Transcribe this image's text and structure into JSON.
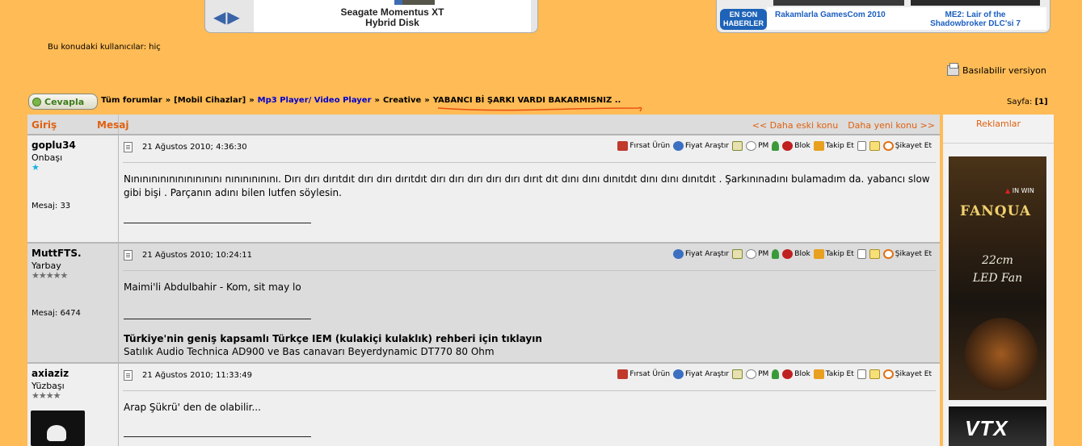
{
  "banners": {
    "left": {
      "title_line1": "Seagate Momentus XT",
      "title_line2": "Hybrid Disk",
      "prev_arrow": "◀",
      "next_arrow": "▶"
    },
    "right": {
      "badge_line1": "EN SON",
      "badge_line2": "HABERLER",
      "news1": "Rakamlarla GamesCom 2010",
      "news2_line1": "ME2: Lair of the",
      "news2_line2": "Shadowbroker DLC'si 7"
    }
  },
  "viewers_text": "Bu konudaki kullanıcılar: hiç",
  "printable_label": "Basılabilir versiyon",
  "reply_button": "Cevapla",
  "breadcrumb": {
    "items": [
      "Tüm forumlar",
      "[Mobil Cihazlar]",
      "Mp3 Player/ Video Player",
      "Creative",
      "YABANCI Bİ ŞARKI VARDI BAKARMISNIZ .."
    ],
    "separator": "»"
  },
  "page_info": {
    "label": "Sayfa:",
    "value": "[1]"
  },
  "thread_header": {
    "login": "Giriş",
    "message": "Mesaj",
    "prev": "<< Daha eski konu",
    "next": "Daha yeni konu >>"
  },
  "action_labels": {
    "deal": "Fırsat Ürün",
    "price": "Fiyat Araştır",
    "pm": "PM",
    "block": "Blok",
    "follow": "Takip Et",
    "report": "Şikayet Et"
  },
  "posts": [
    {
      "username": "goplu34",
      "rank": "Onbaşı",
      "stars": "★",
      "message_count": "Mesaj: 33",
      "timestamp": "21 Ağustos 2010; 4:36:30",
      "text": "Nınınınınınınınınınını nınınınınını. Dırı dırı dırıtdıt dırı dırı dırıtdıt dırı dırı dırı dırı dırı dırıt dıt dını dını dınıtdıt dını dını dınıtdıt . Şarkınınadını bulamadım da. yabancı slow gibi bişi . Parçanın adını bilen lutfen söylesin."
    },
    {
      "username": "MuttFTS.",
      "rank": "Yarbay",
      "stars": "★★★★★",
      "message_count": "Mesaj: 6474",
      "timestamp": "21 Ağustos 2010; 10:24:11",
      "text": "Maimi'li Abdulbahir - Kom, sit may lo",
      "signature_bold": "Türkiye'nin geniş kapsamlı Türkçe IEM (kulakiçi kulaklık) rehberi için tıklayın",
      "signature_sub": "Satılık Audio Technica AD900 ve Bas canavarı Beyerdynamic DT770 80 Ohm"
    },
    {
      "username": "axiaziz",
      "rank": "Yüzbaşı",
      "stars": "★★★★",
      "timestamp": "21 Ağustos 2010; 11:33:49",
      "text": "Arap Şükrü' den de olabilir..."
    }
  ],
  "ads": {
    "header": "Reklamlar",
    "ad1_brand": "FANQUA",
    "ad1_maker": "IN WIN",
    "ad1_line1": "22cm",
    "ad1_line2": "LED Fan",
    "ad2_brand": "VTX"
  },
  "colors": {
    "background": "#ffbb55",
    "accent_orange": "#e06010",
    "link_blue": "#0000cc"
  }
}
